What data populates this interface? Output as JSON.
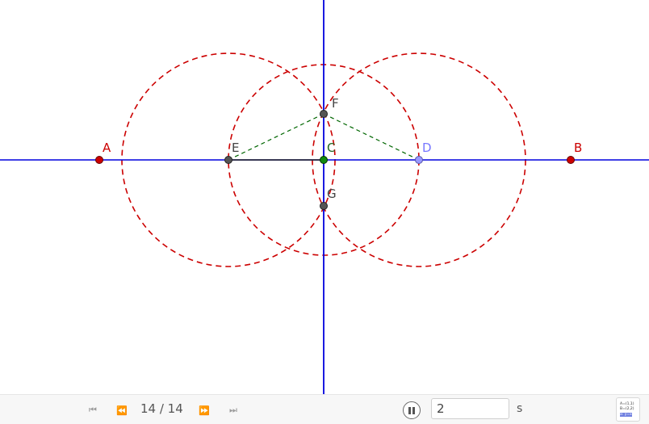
{
  "colors": {
    "axis_line": "#0000dd",
    "circle": "#cc0000",
    "dashed_green": "#006600",
    "point_red": "#cc0000",
    "point_dark": "#444444",
    "point_green": "#007700",
    "point_blue": "#9999ff",
    "label_red": "#cc0000",
    "label_dark": "#444444",
    "label_blue": "#7777ff"
  },
  "points": [
    {
      "id": "A",
      "label": "A",
      "style": "red"
    },
    {
      "id": "B",
      "label": "B",
      "style": "red"
    },
    {
      "id": "C",
      "label": "C",
      "style": "green"
    },
    {
      "id": "D",
      "label": "D",
      "style": "blue"
    },
    {
      "id": "E",
      "label": "E",
      "style": "dark"
    },
    {
      "id": "F",
      "label": "F",
      "style": "dark"
    },
    {
      "id": "G",
      "label": "G",
      "style": "dark"
    }
  ],
  "toolbar": {
    "step_counter": "14 / 14",
    "speed_value": "2",
    "speed_unit": "s",
    "icons": {
      "first": "skip-to-first-icon",
      "prev": "step-back-icon",
      "next": "step-forward-icon",
      "last": "skip-to-last-icon",
      "pause": "pause-icon",
      "algebra": "algebra-view-icon"
    },
    "algebra_icon_rows": [
      "A=(1,1)",
      "B=(2,2)",
      "a: y=x"
    ]
  }
}
